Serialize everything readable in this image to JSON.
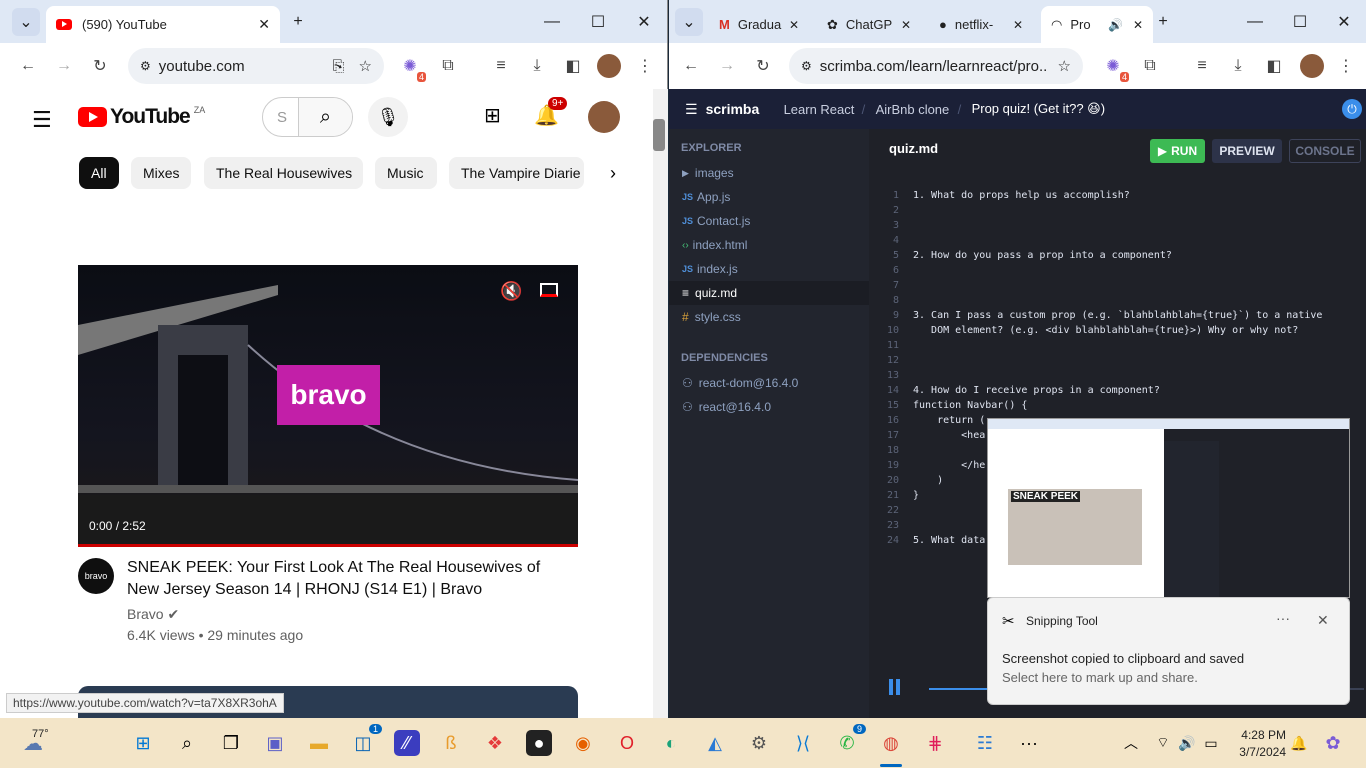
{
  "left_window": {
    "tab_title": "(590) YouTube",
    "url": "youtube.com",
    "ext_badge": "4",
    "youtube": {
      "logo_text": "YouTube",
      "region": "ZA",
      "search_placeholder": "S",
      "notif_count": "9+",
      "chips": [
        "All",
        "Mixes",
        "The Real Housewives",
        "Music",
        "The Vampire Diarie"
      ],
      "video": {
        "time": "0:00 / 2:52",
        "overlay_logo": "bravo",
        "title": "SNEAK PEEK: Your First Look At The Real Housewives of New Jersey Season 14 | RHONJ (S14 E1) | Bravo",
        "channel": "Bravo",
        "channel_avatar": "bravo",
        "meta": "6.4K views • 29 minutes ago"
      },
      "status_url": "https://www.youtube.com/watch?v=ta7X8XR3ohA"
    }
  },
  "right_window": {
    "tabs": [
      "Gradua",
      "ChatGP",
      "netflix-",
      "Pro"
    ],
    "url": "scrimba.com/learn/learnreact/pro...",
    "ext_badge": "4",
    "scrimba": {
      "logo": "scrimba",
      "breadcrumb": [
        "Learn React",
        "AirBnb clone",
        "Prop quiz! (Get it?? 😆)"
      ],
      "explorer_label": "EXPLORER",
      "files": [
        {
          "name": "images",
          "kind": "folder"
        },
        {
          "name": "App.js",
          "kind": "js"
        },
        {
          "name": "Contact.js",
          "kind": "js"
        },
        {
          "name": "index.html",
          "kind": "html"
        },
        {
          "name": "index.js",
          "kind": "js"
        },
        {
          "name": "quiz.md",
          "kind": "md"
        },
        {
          "name": "style.css",
          "kind": "css"
        }
      ],
      "deps_label": "DEPENDENCIES",
      "deps": [
        "react-dom@16.4.0",
        "react@16.4.0"
      ],
      "filename": "quiz.md",
      "run_label": "RUN",
      "preview_label": "PREVIEW",
      "console_label": "CONSOLE",
      "code": [
        "1. What do props help us accomplish?",
        "",
        "",
        "",
        "2. How do you pass a prop into a component?",
        "",
        "",
        "",
        "3. Can I pass a custom prop (e.g. `blahblahblah={true}`) to a native",
        "   DOM element? (e.g. <div blahblahblah={true}>) Why or why not?",
        "",
        "",
        "",
        "4. How do I receive props in a component?",
        "function Navbar() {",
        "    return (",
        "        <hea",
        "",
        "        </he",
        "    )",
        "}",
        "",
        "",
        "5. What data"
      ]
    }
  },
  "snipping": {
    "app": "Snipping Tool",
    "title": "Screenshot copied to clipboard and saved",
    "subtitle": "Select here to mark up and share.",
    "thumb_caption": "SNEAK PEEK"
  },
  "taskbar": {
    "weather": "77°",
    "time": "4:28 PM",
    "date": "3/7/2024",
    "badges": {
      "store": "1",
      "whatsapp": "9"
    }
  }
}
